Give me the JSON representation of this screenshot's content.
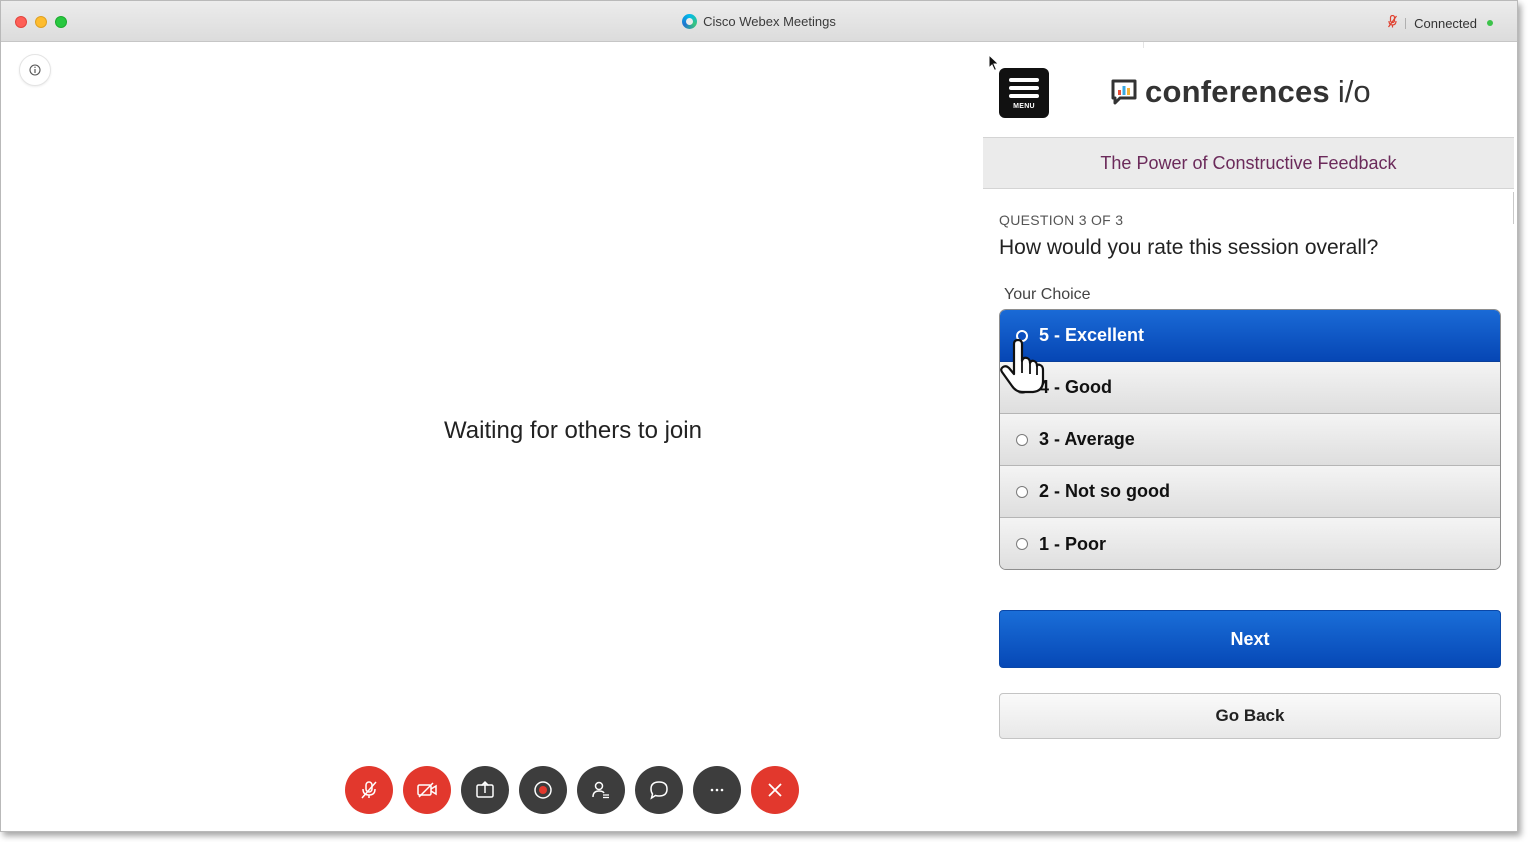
{
  "window": {
    "title": "Cisco Webex Meetings",
    "status": "Connected"
  },
  "meeting": {
    "waiting_text": "Waiting for others to join",
    "controls": [
      {
        "icon": "mic-muted-icon",
        "color": "#e2382d"
      },
      {
        "icon": "video-off-icon",
        "color": "#e2382d"
      },
      {
        "icon": "share-icon",
        "color": "#3d3d3d"
      },
      {
        "icon": "record-icon",
        "color": "#3d3d3d"
      },
      {
        "icon": "participants-icon",
        "color": "#3d3d3d"
      },
      {
        "icon": "chat-icon",
        "color": "#3d3d3d"
      },
      {
        "icon": "more-icon",
        "color": "#3d3d3d"
      },
      {
        "icon": "leave-icon",
        "color": "#e2382d"
      }
    ]
  },
  "panel": {
    "menu_label": "MENU",
    "brand_name": "conferences",
    "brand_suffix": "i/o",
    "session_title": "The Power of Constructive Feedback",
    "question_counter": "QUESTION 3 OF 3",
    "question": "How would you rate this session overall?",
    "choice_label": "Your Choice",
    "options": [
      {
        "label": "5 - Excellent",
        "selected": true
      },
      {
        "label": "4 - Good",
        "selected": false
      },
      {
        "label": "3 - Average",
        "selected": false
      },
      {
        "label": "2 - Not so good",
        "selected": false
      },
      {
        "label": "1 - Poor",
        "selected": false
      }
    ],
    "next_label": "Next",
    "back_label": "Go Back",
    "accent_color": "#0b56c4",
    "session_title_color": "#6b2a5a"
  }
}
